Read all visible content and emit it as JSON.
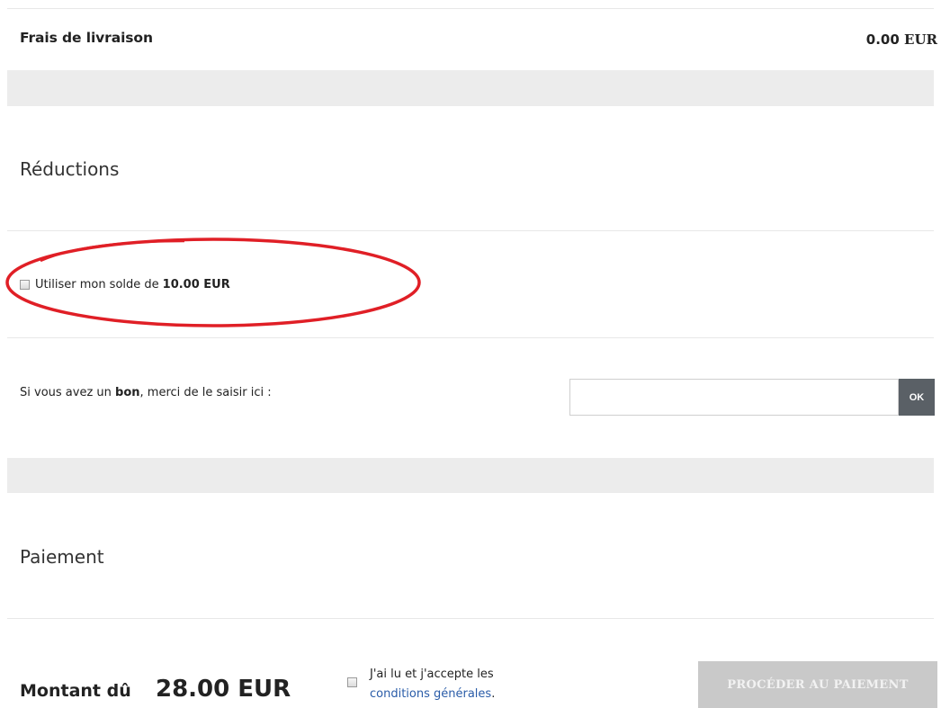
{
  "shipping": {
    "label": "Frais de livraison",
    "amount": "0.00",
    "currency": "EUR"
  },
  "discounts": {
    "title": "Réductions",
    "balance": {
      "prefix": "Utiliser mon solde de",
      "amount": "10.00 EUR",
      "checked": false
    },
    "voucher": {
      "label_before": "Si vous avez un ",
      "label_bold": "bon",
      "label_after": ", merci de le saisir ici :",
      "input_value": "",
      "submit_label": "OK"
    }
  },
  "payment": {
    "title": "Paiement",
    "amount_due_label": "Montant dû",
    "amount_due_value": "28.00 EUR",
    "terms": {
      "prefix": "J'ai lu et j'accepte les",
      "link_text": "conditions générales",
      "suffix": ".",
      "checked": false
    },
    "proceed_label": "PROCÉDER AU PAIEMENT"
  },
  "colors": {
    "annotation_ring": "#e01f26",
    "ok_button_bg": "#5a6066",
    "link": "#2a5ca8",
    "disabled_button_bg": "#c9c9c9",
    "band_bg": "#ececec"
  }
}
